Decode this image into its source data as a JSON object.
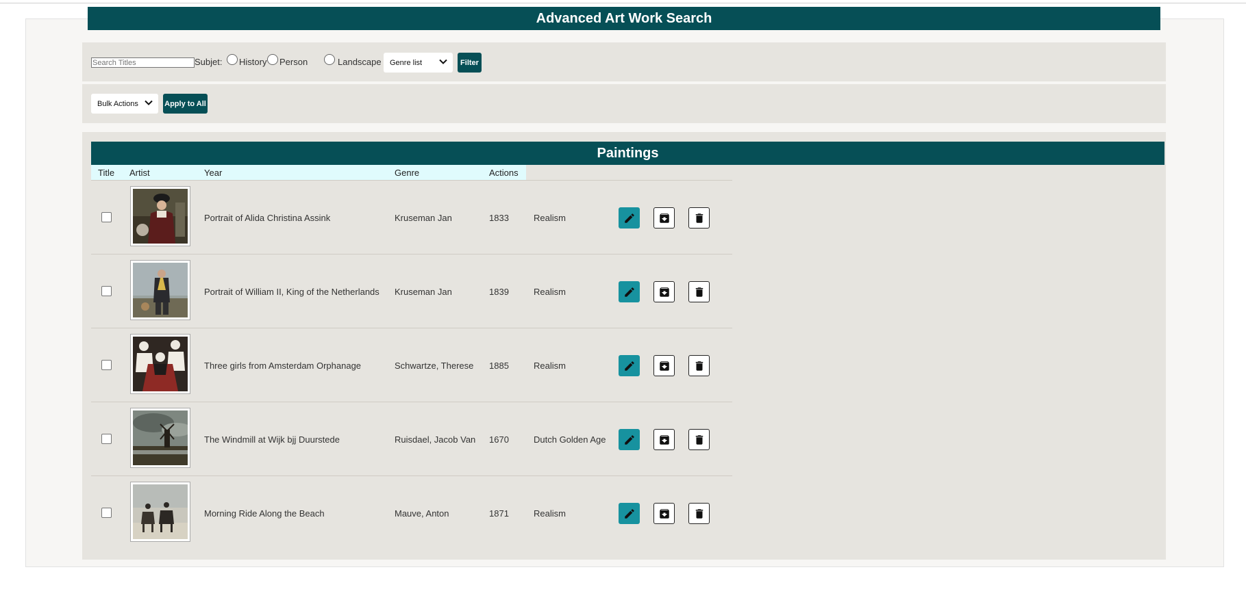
{
  "header": {
    "title": "Advanced Art Work Search"
  },
  "filter": {
    "search_placeholder": "Search Titles",
    "subject_label": "Subjet:",
    "subjects": [
      "History",
      "Person",
      "Landscape"
    ],
    "genre_select": "Genre list",
    "filter_button": "Filter"
  },
  "bulk": {
    "select": "Bulk Actions",
    "apply_button": "Apply to All"
  },
  "paintings": {
    "title": "Paintings",
    "columns": [
      "Title",
      "Artist",
      "Year",
      "Genre",
      "Actions"
    ],
    "rows": [
      {
        "title": "Portrait of Alida Christina Assink",
        "artist": "Kruseman Jan",
        "year": "1833",
        "genre": "Realism"
      },
      {
        "title": "Portrait of William II, King of the Netherlands",
        "artist": "Kruseman Jan",
        "year": "1839",
        "genre": "Realism"
      },
      {
        "title": "Three girls from Amsterdam Orphanage",
        "artist": "Schwartze, Therese",
        "year": "1885",
        "genre": "Realism"
      },
      {
        "title": "The Windmill at Wijk bjj Duurstede",
        "artist": "Ruisdael, Jacob Van",
        "year": "1670",
        "genre": "Dutch Golden Age"
      },
      {
        "title": "Morning Ride Along the Beach",
        "artist": "Mauve, Anton",
        "year": "1871",
        "genre": "Realism"
      }
    ]
  },
  "icons": {
    "edit": "pencil-icon",
    "archive": "archive-icon",
    "delete": "trash-icon",
    "dropdown": "chevron-down-icon"
  },
  "colors": {
    "header": "#064f56",
    "edit_button": "#17929f",
    "panel": "#e6e4df",
    "table_header": "#e0fbfd"
  }
}
